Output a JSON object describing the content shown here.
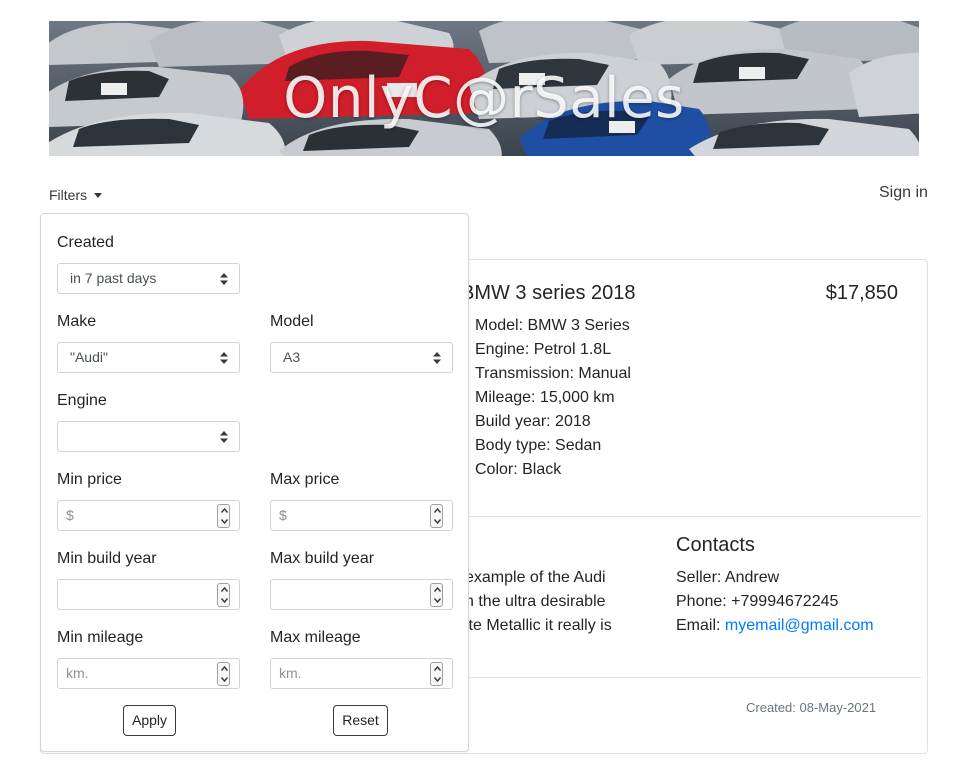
{
  "banner": {
    "title": "OnlyC@rSales"
  },
  "nav": {
    "filters_label": "Filters",
    "signin_label": "Sign in"
  },
  "listing": {
    "title": "BMW 3 series 2018",
    "price": "$17,850",
    "specs": [
      "Model: BMW 3 Series",
      "Engine: Petrol 1.8L",
      "Transmission: Manual",
      "Mileage: 15,000 km",
      "Build year: 2018",
      "Body type: Sedan",
      "Color: Black"
    ],
    "description_lines": [
      "example of the Audi",
      "n the ultra desirable",
      "ite Metallic it really is"
    ],
    "contacts": {
      "heading": "Contacts",
      "seller": "Seller: Andrew",
      "phone": "Phone: +79994672245",
      "email_label": "Email: ",
      "email": "myemail@gmail.com"
    },
    "created": "Created: 08-May-2021"
  },
  "filters": {
    "created": {
      "label": "Created",
      "value": "in 7 past days"
    },
    "make": {
      "label": "Make",
      "value": "\"Audi\""
    },
    "model": {
      "label": "Model",
      "value": "A3"
    },
    "engine": {
      "label": "Engine",
      "value": ""
    },
    "min_price": {
      "label": "Min price",
      "placeholder": "$"
    },
    "max_price": {
      "label": "Max price",
      "placeholder": "$"
    },
    "min_build_year": {
      "label": "Min build year",
      "placeholder": ""
    },
    "max_build_year": {
      "label": "Max build year",
      "placeholder": ""
    },
    "min_mileage": {
      "label": "Min mileage",
      "placeholder": "km."
    },
    "max_mileage": {
      "label": "Max mileage",
      "placeholder": "km."
    },
    "apply_label": "Apply",
    "reset_label": "Reset"
  },
  "colors": {
    "link": "#007bff",
    "text": "#212529",
    "border": "#ced4da"
  }
}
